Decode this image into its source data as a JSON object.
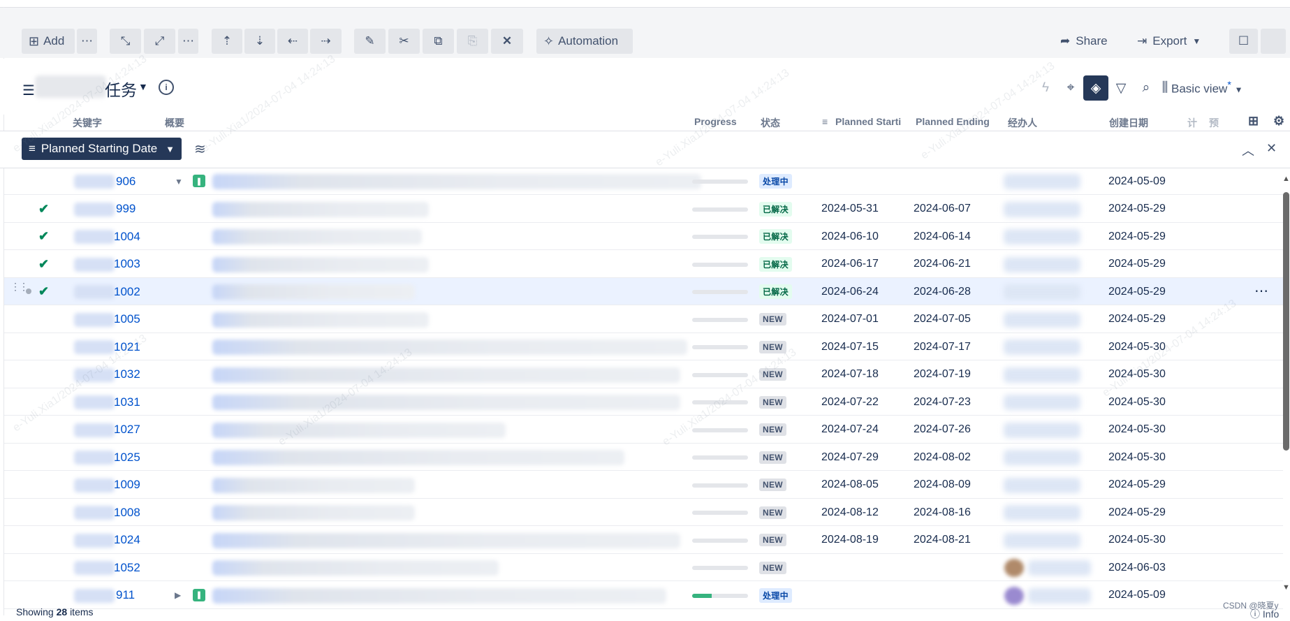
{
  "toolbar": {
    "add_label": "Add",
    "automation_label": "Automation",
    "share_label": "Share",
    "export_label": "Export",
    "icons": [
      "plus-icon",
      "more-icon",
      "expand-icon",
      "collapse-icon",
      "more-icon",
      "move-up-icon",
      "move-down-icon",
      "outdent-icon",
      "indent-icon",
      "edit-icon",
      "cut-icon",
      "copy-icon",
      "paste-icon",
      "delete-icon",
      "wand-icon",
      "share-icon",
      "export-icon",
      "panel-icon"
    ]
  },
  "title": {
    "text": "任务",
    "view_label": "Basic view",
    "view_modified_mark": "*"
  },
  "columns": {
    "key": "关键字",
    "summary": "概要",
    "progress": "Progress",
    "status": "状态",
    "planned_start": "Planned Starti",
    "planned_end": "Planned Ending",
    "assignee": "经办人",
    "created": "创建日期",
    "col_extra1": "计",
    "col_extra2": "预"
  },
  "grouping": {
    "label": "Planned Starting Date"
  },
  "status_labels": {
    "in_progress": "处理中",
    "resolved": "已解决",
    "new": "NEW"
  },
  "rows": [
    {
      "key": "906",
      "status": "处理中",
      "start": "",
      "end": "",
      "created": "2024-05-09",
      "progress": 0,
      "epic": true,
      "expanded": true,
      "done": false
    },
    {
      "key": "999",
      "status": "已解决",
      "start": "2024-05-31",
      "end": "2024-06-07",
      "created": "2024-05-29",
      "progress": 0,
      "done": true
    },
    {
      "key": "1004",
      "status": "已解决",
      "start": "2024-06-10",
      "end": "2024-06-14",
      "created": "2024-05-29",
      "progress": 0,
      "done": true
    },
    {
      "key": "1003",
      "status": "已解决",
      "start": "2024-06-17",
      "end": "2024-06-21",
      "created": "2024-05-29",
      "progress": 0,
      "done": true
    },
    {
      "key": "1002",
      "status": "已解决",
      "start": "2024-06-24",
      "end": "2024-06-28",
      "created": "2024-05-29",
      "progress": 0,
      "done": true,
      "selected": true
    },
    {
      "key": "1005",
      "status": "NEW",
      "start": "2024-07-01",
      "end": "2024-07-05",
      "created": "2024-05-29",
      "progress": 0,
      "done": false
    },
    {
      "key": "1021",
      "status": "NEW",
      "start": "2024-07-15",
      "end": "2024-07-17",
      "created": "2024-05-30",
      "progress": 0,
      "done": false
    },
    {
      "key": "1032",
      "status": "NEW",
      "start": "2024-07-18",
      "end": "2024-07-19",
      "created": "2024-05-30",
      "progress": 0,
      "done": false
    },
    {
      "key": "1031",
      "status": "NEW",
      "start": "2024-07-22",
      "end": "2024-07-23",
      "created": "2024-05-30",
      "progress": 0,
      "done": false
    },
    {
      "key": "1027",
      "status": "NEW",
      "start": "2024-07-24",
      "end": "2024-07-26",
      "created": "2024-05-30",
      "progress": 0,
      "done": false
    },
    {
      "key": "1025",
      "status": "NEW",
      "start": "2024-07-29",
      "end": "2024-08-02",
      "created": "2024-05-30",
      "progress": 0,
      "done": false
    },
    {
      "key": "1009",
      "status": "NEW",
      "start": "2024-08-05",
      "end": "2024-08-09",
      "created": "2024-05-29",
      "progress": 0,
      "done": false
    },
    {
      "key": "1008",
      "status": "NEW",
      "start": "2024-08-12",
      "end": "2024-08-16",
      "created": "2024-05-29",
      "progress": 0,
      "done": false
    },
    {
      "key": "1024",
      "status": "NEW",
      "start": "2024-08-19",
      "end": "2024-08-21",
      "created": "2024-05-30",
      "progress": 0,
      "done": false
    },
    {
      "key": "1052",
      "status": "NEW",
      "start": "",
      "end": "",
      "created": "2024-06-03",
      "progress": 0,
      "done": false,
      "avatar": "#b08a6a"
    },
    {
      "key": "911",
      "status": "处理中",
      "start": "",
      "end": "",
      "created": "2024-05-09",
      "progress": 0.35,
      "epic": true,
      "expanded": false,
      "done": false,
      "avatar": "#9a8ad0"
    }
  ],
  "footer": {
    "prefix": "Showing",
    "count": "28",
    "suffix": "items",
    "info_label": "Info",
    "credit": "CSDN @晓夏y"
  },
  "watermark": "e-Yuli.Xia1/2024-07-04 14:24:13",
  "colors": {
    "accent_dark": "#253858",
    "link": "#0052cc",
    "success": "#00875a"
  }
}
